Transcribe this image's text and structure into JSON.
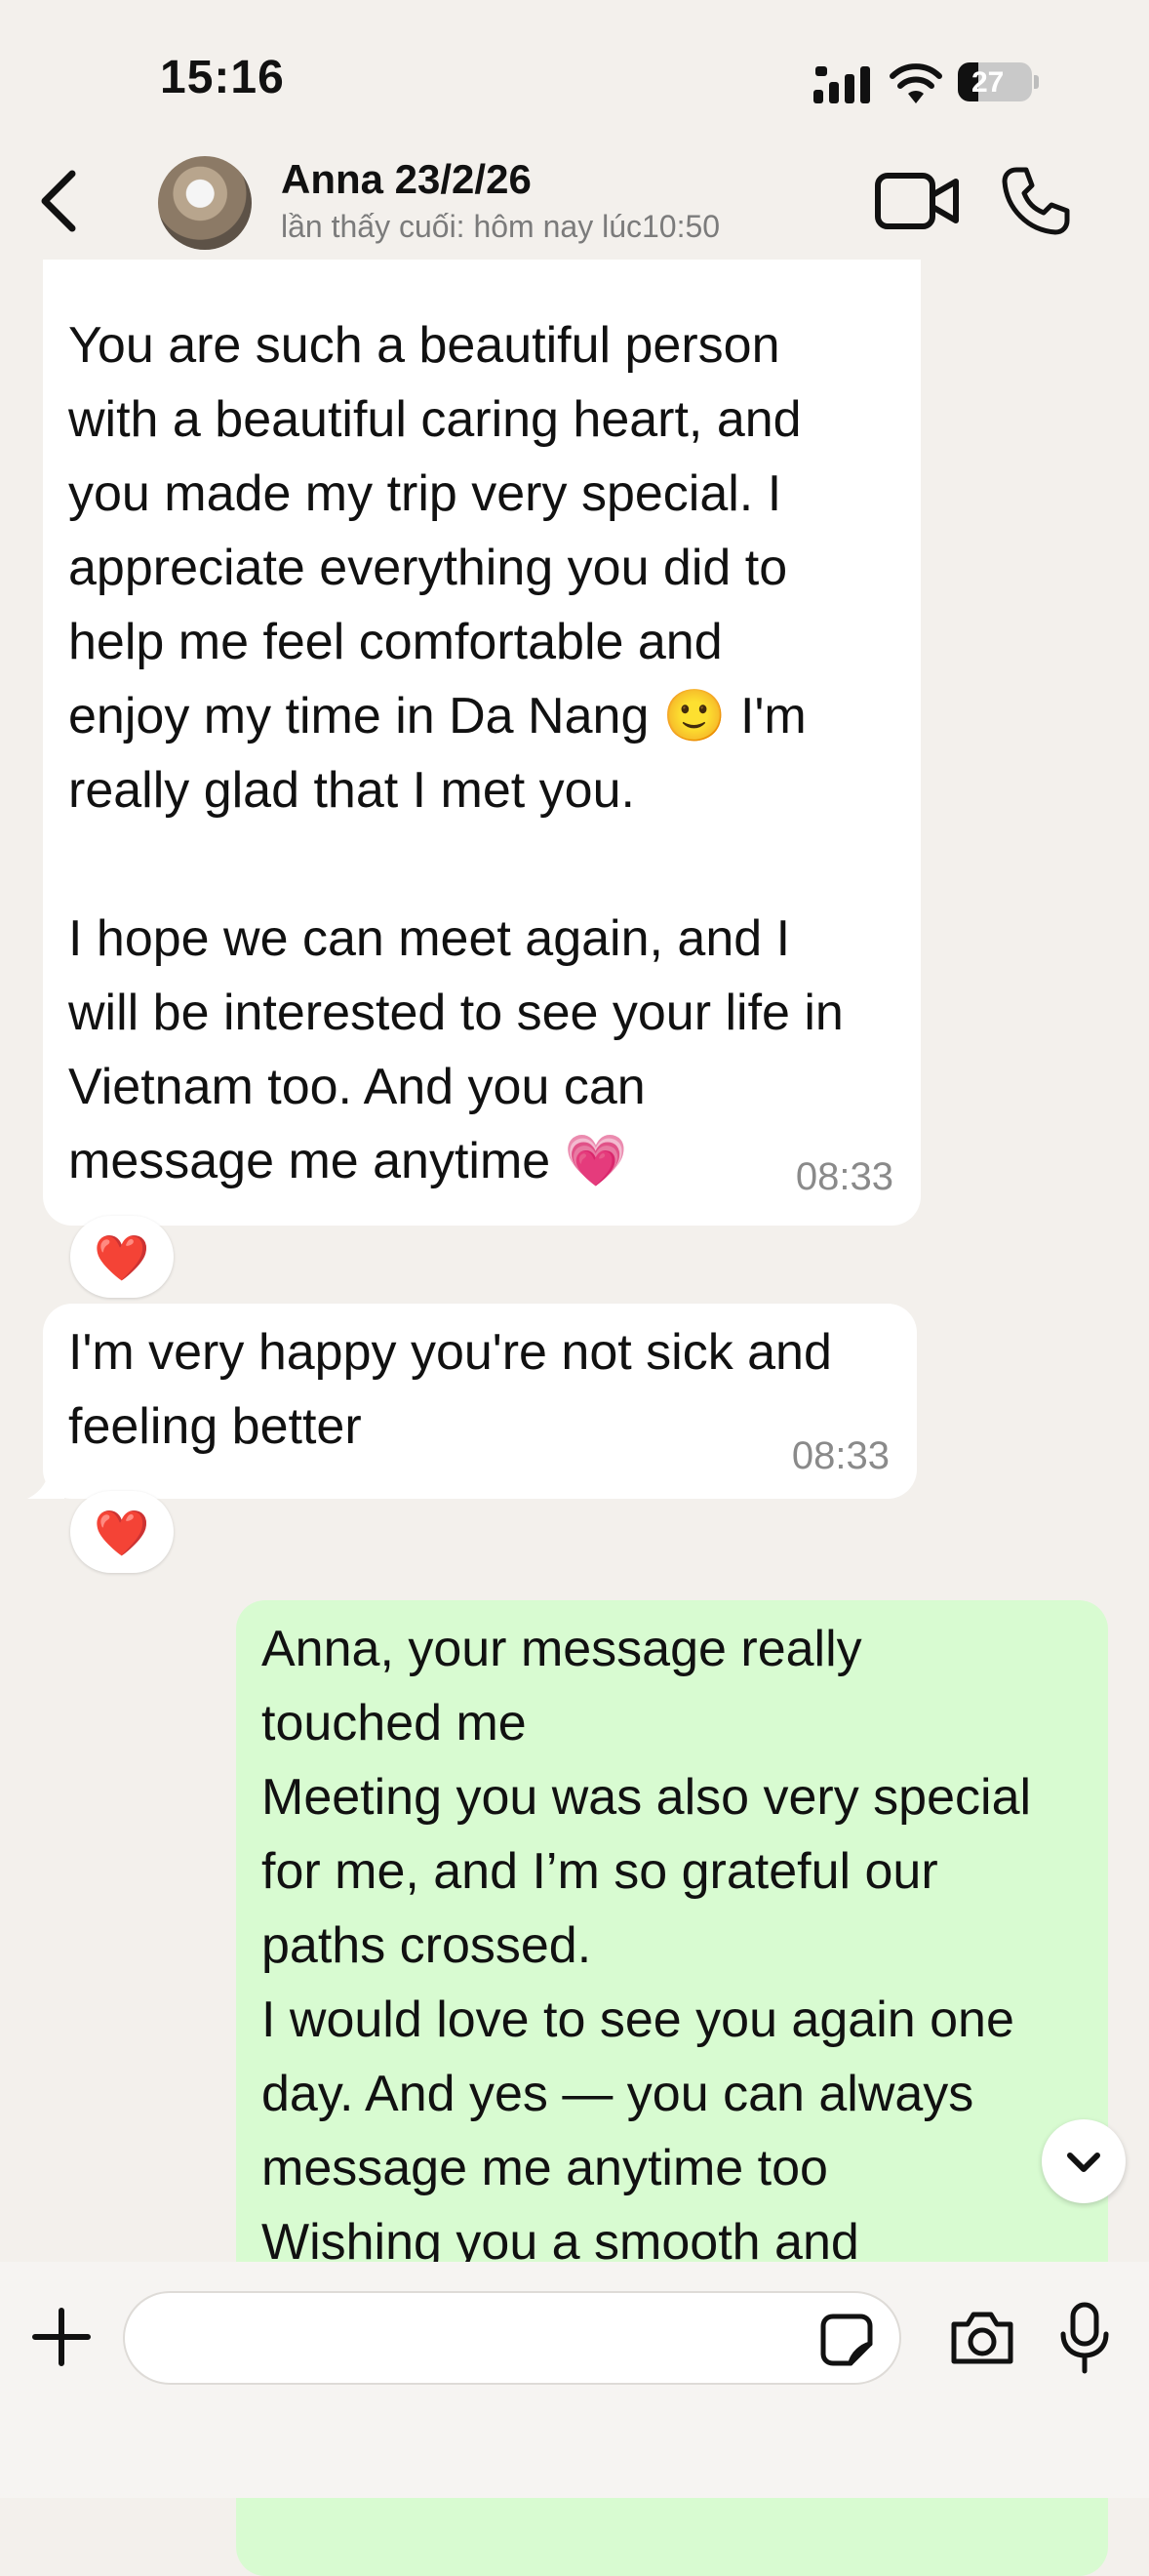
{
  "status_bar": {
    "time": "15:16",
    "battery_level": "27"
  },
  "header": {
    "contact_name": "Anna 23/2/26",
    "last_seen": "lần thấy cuối: hôm nay lúc10:50"
  },
  "messages": [
    {
      "direction": "incoming",
      "text": "You are such a beautiful person\nwith a beautiful caring heart, and\nyou made my trip very special. I\nappreciate everything you did to\nhelp me feel comfortable and\nenjoy my time in Da Nang 🙂 I'm\nreally glad that I met you.\n\nI hope we can meet again, and I\nwill be interested to see your life in\nVietnam too. And you can\nmessage me anytime 💗",
      "time": "08:33",
      "reaction": "❤️"
    },
    {
      "direction": "incoming",
      "text": "I'm very happy you're not sick and\nfeeling better",
      "time": "08:33",
      "reaction": "❤️"
    },
    {
      "direction": "outgoing",
      "text": "Anna, your message really\ntouched me\nMeeting you was also very special\nfor me, and I’m so grateful our\npaths crossed.\nI would love to see you again one\nday. And yes — you can always\nmessage me anytime too\nWishing you a smooth and"
    }
  ],
  "composer": {
    "placeholder": ""
  },
  "colors": {
    "background": "#f3f0ec",
    "incoming_bubble": "#ffffff",
    "outgoing_bubble": "#d8fbd1"
  },
  "icons": [
    "chevron-left-icon",
    "video-camera-icon",
    "phone-icon",
    "plus-icon",
    "sticker-icon",
    "camera-icon",
    "microphone-icon",
    "chevron-down-icon"
  ]
}
